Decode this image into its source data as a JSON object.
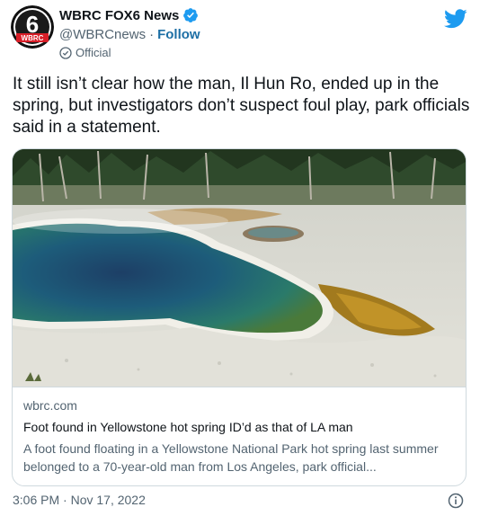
{
  "account": {
    "display_name": "WBRC FOX6 News",
    "handle": "@WBRCnews",
    "separator": "·",
    "follow_label": "Follow",
    "label": "Official",
    "avatar_logo_text": "WBRC",
    "avatar_number": "6"
  },
  "tweet": {
    "text": "It still isn’t clear how the man, Il Hun Ro, ended up in the spring, but investigators don’t suspect foul play, park officials said in a statement."
  },
  "card": {
    "domain": "wbrc.com",
    "title": "Foot found in Yellowstone hot spring ID’d as that of LA man",
    "description": "A foot found floating in a Yellowstone National Park hot spring last summer belonged to a 70-year-old man from Los Angeles, park official..."
  },
  "footer": {
    "timestamp": "3:06 PM · Nov 17, 2022"
  },
  "colors": {
    "verified": "#1d9bf0",
    "twitter_blue": "#1d9bf0",
    "link": "#1d6fa5",
    "secondary_text": "#536471"
  },
  "icons": [
    "verified-badge-icon",
    "official-check-icon",
    "twitter-bird-icon",
    "info-icon"
  ]
}
